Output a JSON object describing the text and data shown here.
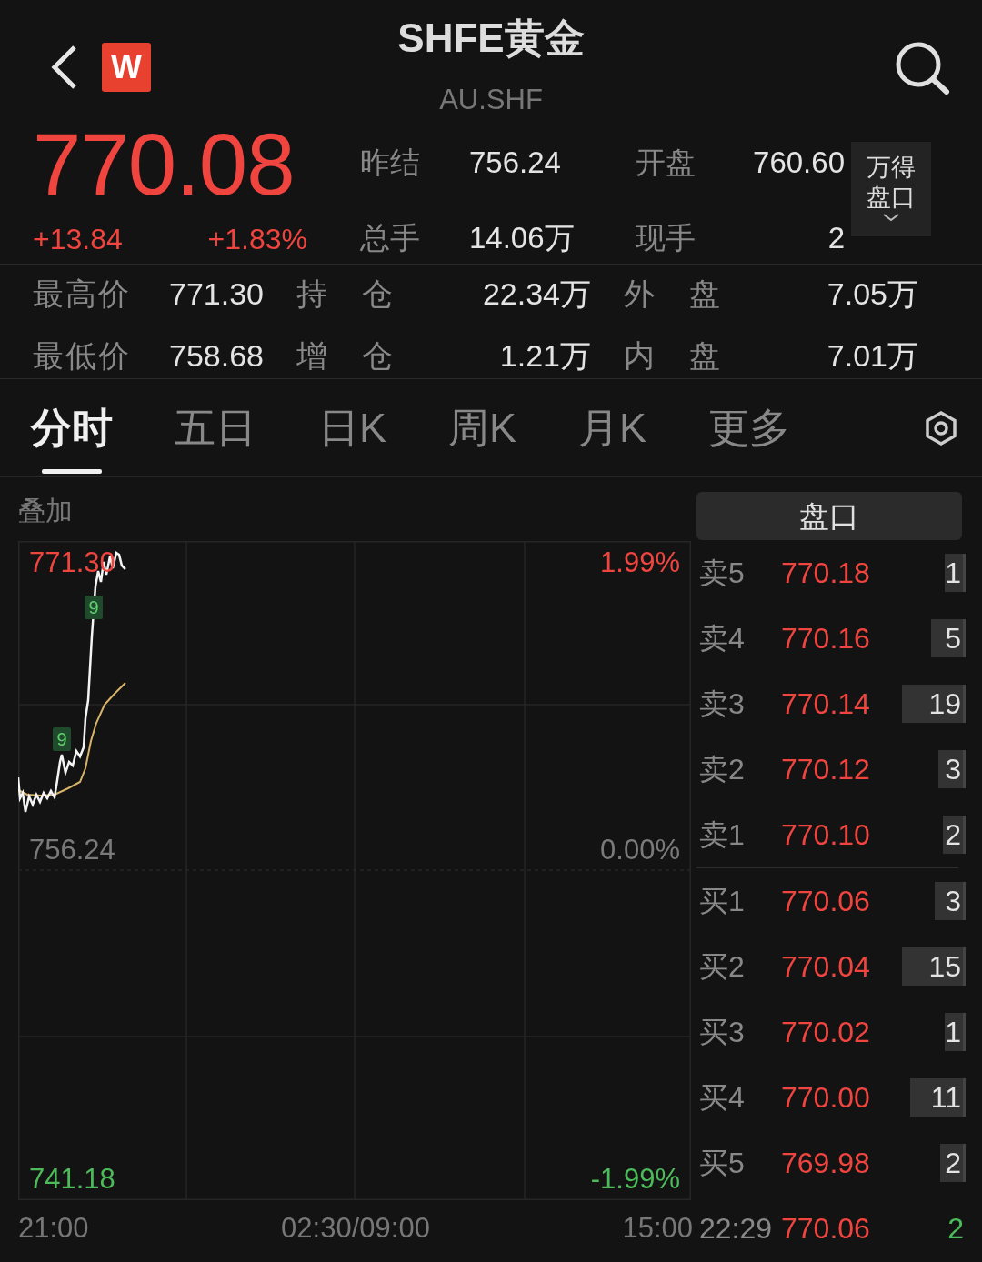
{
  "header": {
    "logo": "W",
    "title": "SHFE黄金",
    "subtitle": "AU.SHF"
  },
  "quote": {
    "price": "770.08",
    "change": "+13.84",
    "change_pct": "+1.83%",
    "stats": [
      {
        "label": "昨结",
        "value": "756.24"
      },
      {
        "label": "开盘",
        "value": "760.60"
      },
      {
        "label": "总手",
        "value": "14.06万"
      },
      {
        "label": "现手",
        "value": "2"
      }
    ],
    "panel_button": "万得盘口"
  },
  "details": [
    {
      "label": "最高价",
      "value": "771.30"
    },
    {
      "label": "持仓",
      "value": "22.34万"
    },
    {
      "label": "外盘",
      "value": "7.05万"
    },
    {
      "label": "最低价",
      "value": "758.68"
    },
    {
      "label": "增仓",
      "value": "1.21万"
    },
    {
      "label": "内盘",
      "value": "7.01万"
    }
  ],
  "tabs": [
    {
      "label": "分时",
      "selected": true
    },
    {
      "label": "五日",
      "selected": false
    },
    {
      "label": "日K",
      "selected": false
    },
    {
      "label": "周K",
      "selected": false
    },
    {
      "label": "月K",
      "selected": false
    },
    {
      "label": "更多",
      "selected": false
    }
  ],
  "chart": {
    "overlay_label": "叠加",
    "price_labels": [
      {
        "text": "771.30",
        "kind": "high"
      },
      {
        "text": "756.24",
        "kind": "base"
      },
      {
        "text": "741.18",
        "kind": "low"
      }
    ],
    "pct_labels": [
      {
        "text": "1.99%",
        "kind": "high"
      },
      {
        "text": "0.00%",
        "kind": "base"
      },
      {
        "text": "-1.99%",
        "kind": "low"
      }
    ],
    "time_labels": [
      "21:00",
      "02:30/09:00",
      "15:00"
    ],
    "markers": [
      {
        "text": "9"
      },
      {
        "text": "9"
      }
    ]
  },
  "order_book": {
    "title": "盘口",
    "asks": [
      {
        "label": "卖5",
        "price": "770.18",
        "volume": "1"
      },
      {
        "label": "卖4",
        "price": "770.16",
        "volume": "5"
      },
      {
        "label": "卖3",
        "price": "770.14",
        "volume": "19"
      },
      {
        "label": "卖2",
        "price": "770.12",
        "volume": "3"
      },
      {
        "label": "卖1",
        "price": "770.10",
        "volume": "2"
      }
    ],
    "bids": [
      {
        "label": "买1",
        "price": "770.06",
        "volume": "3"
      },
      {
        "label": "买2",
        "price": "770.04",
        "volume": "15"
      },
      {
        "label": "买3",
        "price": "770.02",
        "volume": "1"
      },
      {
        "label": "买4",
        "price": "770.00",
        "volume": "11"
      },
      {
        "label": "买5",
        "price": "769.98",
        "volume": "2"
      }
    ],
    "last_trade": {
      "time": "22:29",
      "price": "770.06",
      "volume": "2"
    }
  }
}
